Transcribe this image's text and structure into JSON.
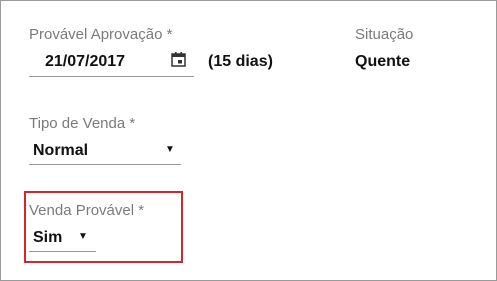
{
  "fields": {
    "approval": {
      "label": "Provável Aprovação *",
      "value": "21/07/2017",
      "days": "(15 dias)"
    },
    "situation": {
      "label": "Situação",
      "value": "Quente"
    },
    "sale_type": {
      "label": "Tipo de Venda *",
      "value": "Normal"
    },
    "probable_sale": {
      "label": "Venda Provável *",
      "value": "Sim"
    }
  },
  "icons": {
    "calendar": "calendar-icon",
    "dropdown": "caret-down-icon"
  },
  "colors": {
    "highlight_border": "#d3262f",
    "label": "#7a7a7a",
    "value": "#111111"
  }
}
